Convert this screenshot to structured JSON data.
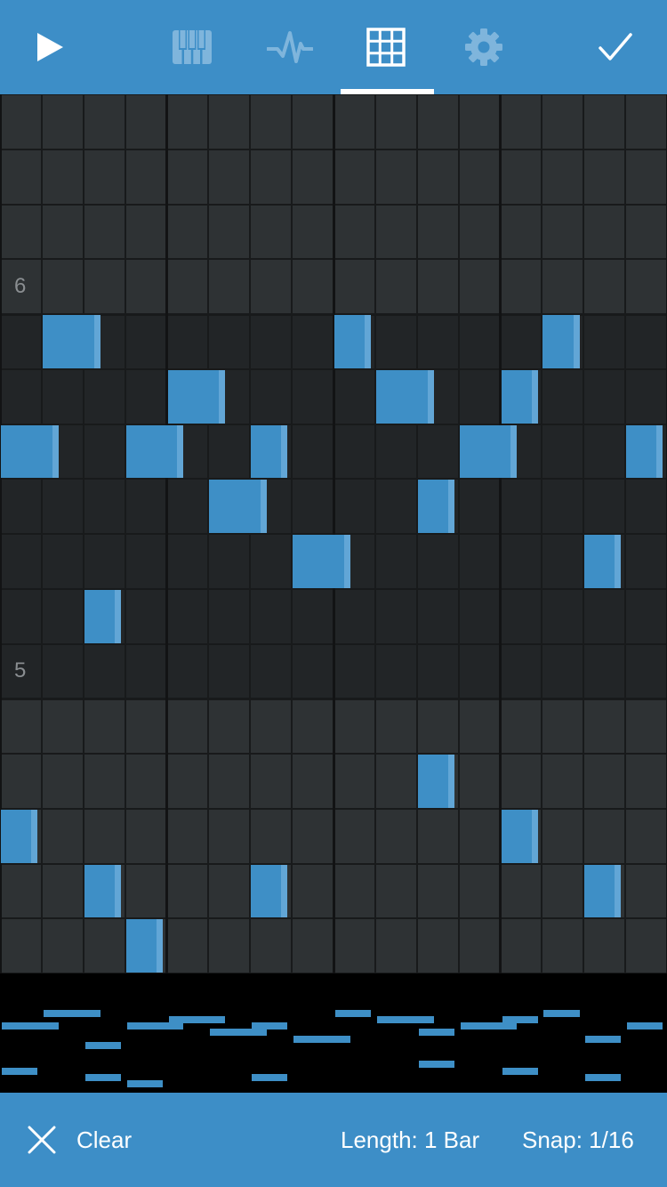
{
  "toolbar": {
    "play_icon": "play-icon",
    "tabs": [
      {
        "name": "piano-keys-icon",
        "active": false
      },
      {
        "name": "waveform-icon",
        "active": false
      },
      {
        "name": "grid-icon",
        "active": true
      },
      {
        "name": "gear-icon",
        "active": false
      }
    ],
    "done_icon": "checkmark-icon"
  },
  "sequencer": {
    "octave_labels": [
      "6",
      "5"
    ],
    "columns": 16,
    "notes": [
      {
        "col": 1,
        "row": 4,
        "len": 1.4
      },
      {
        "col": 8,
        "row": 4,
        "len": 0.9
      },
      {
        "col": 13,
        "row": 4,
        "len": 0.9
      },
      {
        "col": 4,
        "row": 5,
        "len": 1.4
      },
      {
        "col": 9,
        "row": 5,
        "len": 1.4
      },
      {
        "col": 12,
        "row": 5,
        "len": 0.9
      },
      {
        "col": 0,
        "row": 6,
        "len": 1.4
      },
      {
        "col": 3,
        "row": 6,
        "len": 1.4
      },
      {
        "col": 6,
        "row": 6,
        "len": 0.9
      },
      {
        "col": 11,
        "row": 6,
        "len": 1.4
      },
      {
        "col": 15,
        "row": 6,
        "len": 0.9
      },
      {
        "col": 5,
        "row": 7,
        "len": 1.4
      },
      {
        "col": 10,
        "row": 7,
        "len": 0.9
      },
      {
        "col": 7,
        "row": 8,
        "len": 1.4
      },
      {
        "col": 14,
        "row": 8,
        "len": 0.9
      },
      {
        "col": 2,
        "row": 9,
        "len": 0.9
      },
      {
        "col": 10,
        "row": 12,
        "len": 0.9
      },
      {
        "col": 0,
        "row": 13,
        "len": 0.9
      },
      {
        "col": 12,
        "row": 13,
        "len": 0.9
      },
      {
        "col": 2,
        "row": 14,
        "len": 0.9
      },
      {
        "col": 6,
        "row": 14,
        "len": 0.9
      },
      {
        "col": 14,
        "row": 14,
        "len": 0.9
      },
      {
        "col": 3,
        "row": 15,
        "len": 0.9
      }
    ]
  },
  "bottom": {
    "clear_icon": "close-icon",
    "clear_label": "Clear",
    "length_label": "Length: 1 Bar",
    "snap_label": "Snap: 1/16"
  },
  "colors": {
    "bar": "#3d8ec7",
    "note": "#3e8fc6",
    "note_edge": "#62a6d6",
    "row_light": "#2e3234",
    "row_dark": "#222527"
  }
}
